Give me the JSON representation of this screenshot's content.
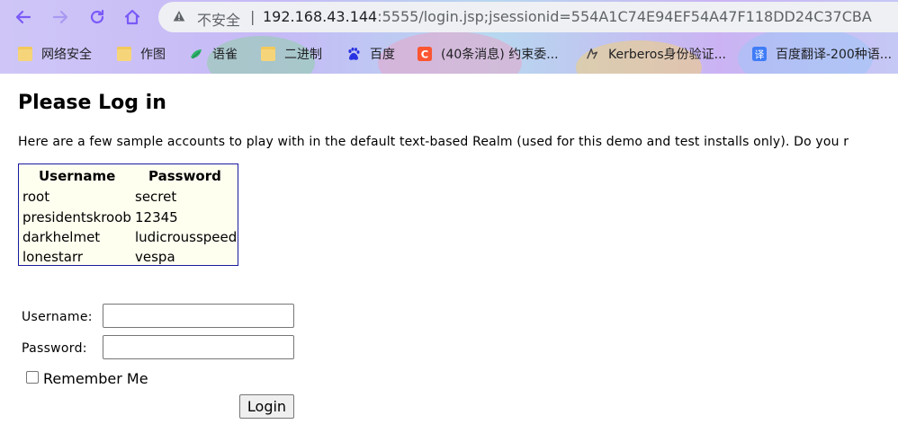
{
  "browser": {
    "security_label": "不安全",
    "separator": "|",
    "url_host": "192.168.43.144",
    "url_rest": ":5555/login.jsp;jsessionid=554A1C74E94EF54A47F118DD24C37CBA",
    "bookmarks": [
      {
        "label": "网络安全",
        "icon": "folder-icon"
      },
      {
        "label": "作图",
        "icon": "folder-icon"
      },
      {
        "label": "语雀",
        "icon": "yuque-icon"
      },
      {
        "label": "二进制",
        "icon": "folder-icon"
      },
      {
        "label": "百度",
        "icon": "baidu-icon"
      },
      {
        "label": "(40条消息) 约束委...",
        "icon": "csdn-icon"
      },
      {
        "label": "Kerberos身份验证...",
        "icon": "kerberos-icon"
      },
      {
        "label": "百度翻译-200种语...",
        "icon": "translate-icon"
      }
    ],
    "colors": {
      "accent": "#7a5af8"
    }
  },
  "page": {
    "title": "Please Log in",
    "intro": "Here are a few sample accounts to play with in the default text-based Realm (used for this demo and test installs only). Do you r",
    "accounts": {
      "headers": [
        "Username",
        "Password"
      ],
      "rows": [
        [
          "root",
          "secret"
        ],
        [
          "presidentskroob",
          "12345"
        ],
        [
          "darkhelmet",
          "ludicrousspeed"
        ],
        [
          "lonestarr",
          "vespa"
        ]
      ]
    },
    "form": {
      "username_label": "Username:",
      "username_value": "",
      "password_label": "Password:",
      "password_value": "",
      "remember_label": "Remember Me",
      "login_label": "Login"
    }
  }
}
